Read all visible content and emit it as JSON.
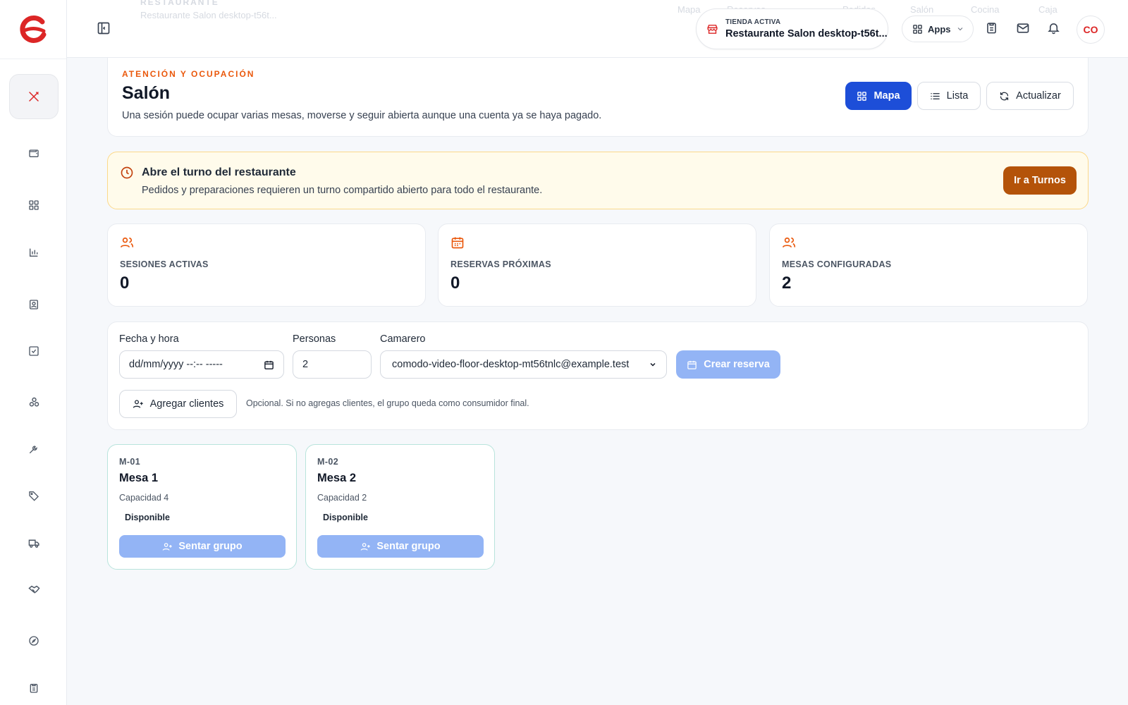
{
  "topbar": {
    "ghost_section": "RESTAURANTE",
    "ghost_subtitle": "Restaurante Salon desktop-t56t...",
    "ghost_tabs": [
      "Mapa",
      "Reservas",
      "Pedidos",
      "Salón",
      "Cocina",
      "Caja"
    ],
    "store_kicker": "TIENDA ACTIVA",
    "store_name": "Restaurante Salon desktop-t56t...",
    "apps_label": "Apps",
    "avatar_initials": "CO"
  },
  "header": {
    "kicker": "ATENCIÓN Y OCUPACIÓN",
    "title": "Salón",
    "description": "Una sesión puede ocupar varias mesas, moverse y seguir abierta aunque una cuenta ya se haya pagado.",
    "view_map": "Mapa",
    "view_list": "Lista",
    "refresh": "Actualizar"
  },
  "alert": {
    "title": "Abre el turno del restaurante",
    "text": "Pedidos y preparaciones requieren un turno compartido abierto para todo el restaurante.",
    "button": "Ir a Turnos"
  },
  "stats": [
    {
      "label": "SESIONES ACTIVAS",
      "value": "0",
      "icon": "users-icon"
    },
    {
      "label": "RESERVAS PRÓXIMAS",
      "value": "0",
      "icon": "calendar-icon"
    },
    {
      "label": "MESAS CONFIGURADAS",
      "value": "2",
      "icon": "users-icon"
    }
  ],
  "form": {
    "datetime_label": "Fecha y hora",
    "datetime_value": "dd/mm/yyyy --:-- -----",
    "people_label": "Personas",
    "people_value": "2",
    "waiter_label": "Camarero",
    "waiter_value": "comodo-video-floor-desktop-mt56tnlc@example.test",
    "create_button": "Crear reserva",
    "add_clients_button": "Agregar clientes",
    "hint": "Opcional. Si no agregas clientes, el grupo queda como consumidor final."
  },
  "tables": [
    {
      "code": "M-01",
      "name": "Mesa 1",
      "capacity": "Capacidad 4",
      "status": "Disponible",
      "button": "Sentar grupo"
    },
    {
      "code": "M-02",
      "name": "Mesa 2",
      "capacity": "Capacidad 2",
      "status": "Disponible",
      "button": "Sentar grupo"
    }
  ],
  "colors": {
    "accent": "#1d4ed8",
    "brand": "#dc2626",
    "warning": "#b45309",
    "kicker": "#ea580c"
  }
}
